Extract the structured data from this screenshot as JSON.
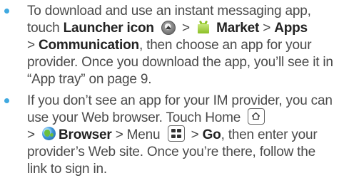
{
  "colors": {
    "bullet": "#3fa9e0",
    "body_text": "#4a4a4a",
    "bold_text": "#222222"
  },
  "icons": [
    "launcher-icon",
    "market-icon",
    "home-key-icon",
    "browser-icon",
    "menu-key-icon"
  ],
  "item1": {
    "l1": "To download and use an instant messaging app,",
    "l2_pre": "touch ",
    "l2_launcher": "Launcher icon",
    "l2_gt1": " > ",
    "l2_market": "Market",
    "l2_gt2": " > ",
    "l2_apps": "Apps",
    "l3_gt": "> ",
    "l3_comm": "Communication",
    "l3_post": ", then choose an app for your",
    "l4": "provider. Once you download the app, you’ll see it in",
    "l5": "“App tray” on page 9."
  },
  "item2": {
    "l1": "If you don’t see an app for your IM provider, you can",
    "l2": "use your Web browser. Touch Home",
    "l3_gt": "> ",
    "l3_browser": "Browser",
    "l3_mid": " > Menu ",
    "l3_gt2": " > ",
    "l3_go": "Go",
    "l3_post": ", then enter your",
    "l4": "provider’s Web site. Once you’re there, follow the",
    "l5": "link to sign in."
  }
}
